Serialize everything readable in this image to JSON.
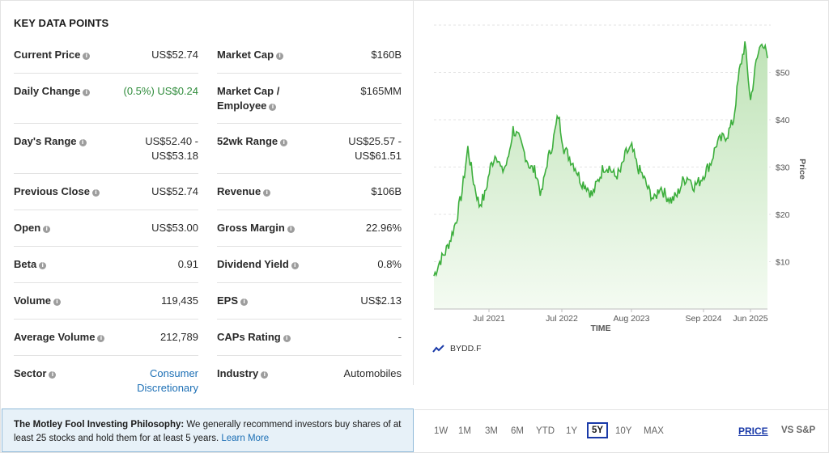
{
  "key_data": {
    "title": "KEY DATA POINTS",
    "left_column": [
      {
        "label": "Current Price",
        "value": "US$52.74"
      },
      {
        "label": "Daily Change",
        "value": "(0.5%) US$0.24"
      },
      {
        "label": "Day's Range",
        "value": "US$52.40 - US$53.18"
      },
      {
        "label": "Previous Close",
        "value": "US$52.74"
      },
      {
        "label": "Open",
        "value": "US$53.00"
      },
      {
        "label": "Beta",
        "value": "0.91"
      },
      {
        "label": "Volume",
        "value": "119,435"
      },
      {
        "label": "Average Volume",
        "value": "212,789"
      },
      {
        "label": "Sector",
        "value": "Consumer Discretionary"
      }
    ],
    "right_column": [
      {
        "label": "Market Cap",
        "value": "$160B"
      },
      {
        "label": "Market Cap / Employee",
        "value": "$165MM"
      },
      {
        "label": "52wk Range",
        "value": "US$25.57 - US$61.51"
      },
      {
        "label": "Revenue",
        "value": "$106B"
      },
      {
        "label": "Gross Margin",
        "value": "22.96%"
      },
      {
        "label": "Dividend Yield",
        "value": "0.8%"
      },
      {
        "label": "EPS",
        "value": "US$2.13"
      },
      {
        "label": "CAPs Rating",
        "value": "-"
      },
      {
        "label": "Industry",
        "value": "Automobiles"
      }
    ]
  },
  "philosophy": {
    "heading": "The Motley Fool Investing Philosophy:",
    "text": "We generally recommend investors buy shares of at least 25 stocks and hold them for at least 5 years.",
    "link": "Learn More"
  },
  "chart": {
    "legend": "BYDD.F",
    "xlabel": "TIME",
    "ylabel": "Price",
    "accent": "#3cae3c",
    "fill_top": "#bfe3b7",
    "fill_bottom": "#f4fbf2"
  },
  "range_buttons": [
    "1W",
    "1M",
    "3M",
    "6M",
    "YTD",
    "1Y",
    "5Y",
    "10Y",
    "MAX"
  ],
  "active_range": "5Y",
  "tabs": {
    "price": "PRICE",
    "vs": "VS S&P"
  },
  "chart_data": {
    "type": "line",
    "title": "",
    "xlabel": "TIME",
    "ylabel": "Price",
    "x_ticks": [
      "Jul 2021",
      "Jul 2022",
      "Aug 2023",
      "Sep 2024",
      "Jun 2025"
    ],
    "y_ticks": [
      "$10",
      "$20",
      "$30",
      "$40",
      "$50"
    ],
    "ylim": [
      0,
      60
    ],
    "grid": true,
    "legend_position": "bottom-left",
    "series": [
      {
        "name": "BYDD.F",
        "x": [
          "2020-08",
          "2020-09",
          "2020-10",
          "2020-11",
          "2020-12",
          "2021-01",
          "2021-02",
          "2021-03",
          "2021-04",
          "2021-05",
          "2021-06",
          "2021-07",
          "2021-08",
          "2021-09",
          "2021-10",
          "2021-11",
          "2021-12",
          "2022-01",
          "2022-02",
          "2022-03",
          "2022-04",
          "2022-05",
          "2022-06",
          "2022-07",
          "2022-08",
          "2022-09",
          "2022-10",
          "2022-11",
          "2022-12",
          "2023-01",
          "2023-02",
          "2023-03",
          "2023-04",
          "2023-05",
          "2023-06",
          "2023-07",
          "2023-08",
          "2023-09",
          "2023-10",
          "2023-11",
          "2023-12",
          "2024-01",
          "2024-02",
          "2024-03",
          "2024-04",
          "2024-05",
          "2024-06",
          "2024-07",
          "2024-08",
          "2024-09",
          "2024-10",
          "2024-11",
          "2024-12",
          "2025-01",
          "2025-02",
          "2025-03",
          "2025-04",
          "2025-05",
          "2025-06",
          "2025-07"
        ],
        "values": [
          7,
          10,
          12,
          15,
          19,
          25,
          34,
          27,
          22,
          24,
          30,
          33,
          29,
          31,
          38,
          36,
          33,
          30,
          29,
          24,
          31,
          35,
          41,
          34,
          32,
          30,
          27,
          26,
          24,
          27,
          30,
          30,
          28,
          29,
          33,
          34,
          30,
          28,
          25,
          23,
          26,
          24,
          23,
          24,
          27,
          28,
          26,
          27,
          29,
          31,
          35,
          36,
          37,
          40,
          50,
          56,
          44,
          52,
          57,
          53
        ]
      }
    ]
  }
}
